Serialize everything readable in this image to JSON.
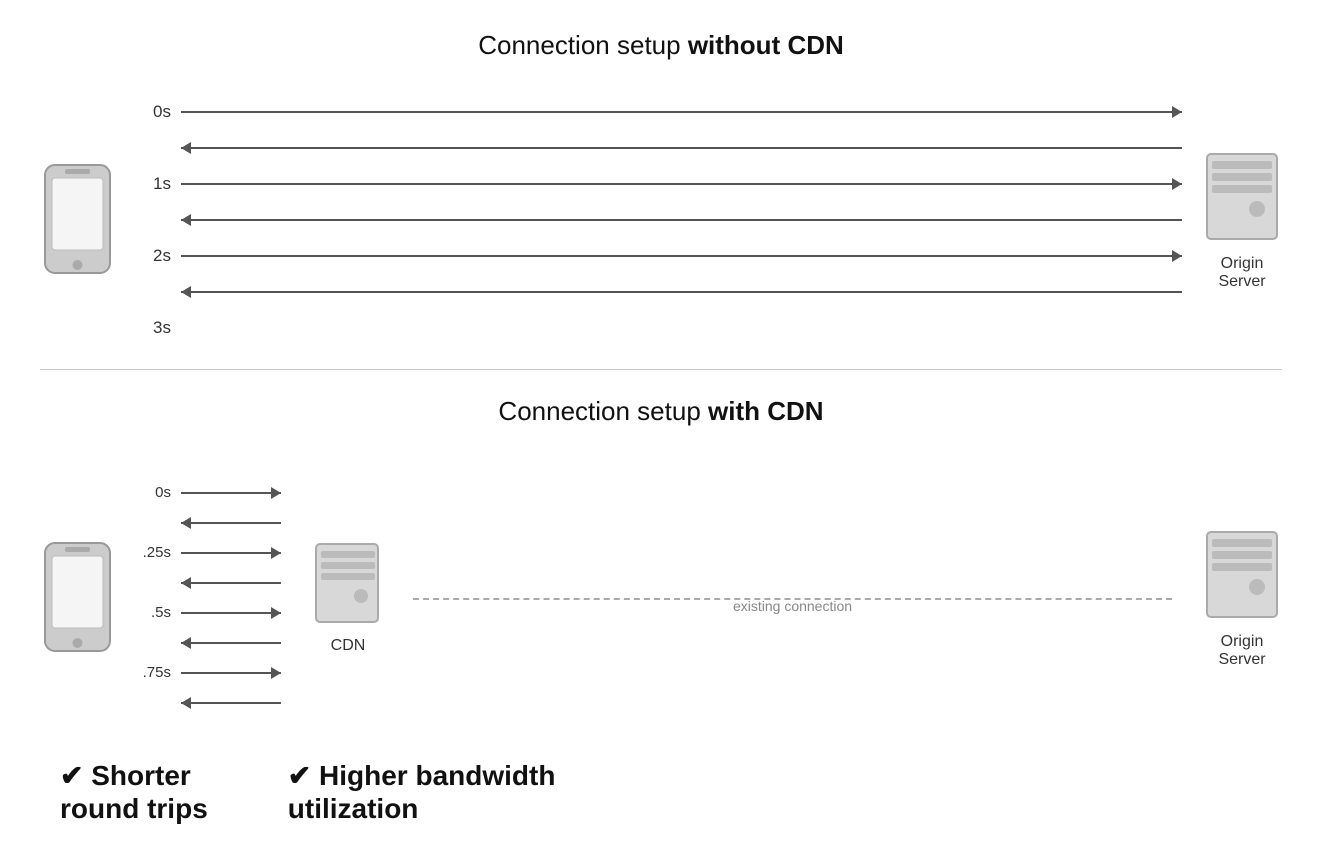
{
  "top": {
    "title_normal": "Connection setup ",
    "title_bold": "without CDN",
    "time_labels": [
      "0s",
      "1s",
      "2s",
      "3s"
    ],
    "server_label": "Origin\nServer"
  },
  "bottom": {
    "title_normal": "Connection setup ",
    "title_bold": "with CDN",
    "time_labels": [
      "0s",
      ".25s",
      ".5s",
      ".75s"
    ],
    "cdn_label": "CDN",
    "server_label": "Origin\nServer",
    "existing_connection": "existing connection",
    "benefit1_check": "✔",
    "benefit1_text": "Shorter\nround trips",
    "benefit2_check": "✔",
    "benefit2_text": "Higher bandwidth\nutilization"
  }
}
